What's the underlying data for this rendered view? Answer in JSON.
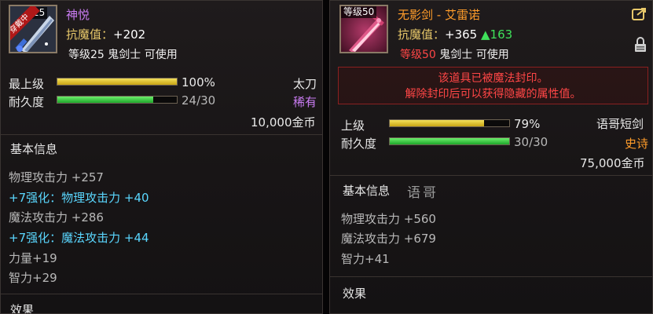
{
  "left": {
    "icon": {
      "level_tag": "25",
      "tag_label": "穿戴中",
      "tag_top": "等"
    },
    "name": "神悦",
    "magic_resist_label": "抗魔值：",
    "magic_resist_value": "+202",
    "requirement": "等级25 鬼剑士 可使用",
    "level_row": {
      "label": "最上级",
      "percent": "100%",
      "fill": 1.0,
      "type": "太刀"
    },
    "durability_row": {
      "label": "耐久度",
      "value": "24/30",
      "fill": 0.8,
      "grade": "稀有"
    },
    "price": "10,000金币",
    "section_basic": "基本信息",
    "stats": [
      {
        "text": "物理攻击力 +257",
        "style": "gray"
      },
      {
        "text": "+7强化：物理攻击力 +40",
        "style": "cyan"
      },
      {
        "text": "魔法攻击力 +286",
        "style": "gray"
      },
      {
        "text": "+7强化：魔法攻击力 +44",
        "style": "cyan"
      },
      {
        "text": "力量+19",
        "style": "gray"
      },
      {
        "text": "智力+29",
        "style": "gray"
      }
    ],
    "section_effect": "效果"
  },
  "right": {
    "icon": {
      "level_tag": "等级50"
    },
    "name": "无影剑 - 艾雷诺",
    "magic_resist_label": "抗魔值：",
    "magic_resist_value": "+365",
    "magic_resist_bonus": "▲163",
    "requirement_level": "等级50",
    "requirement_rest": " 鬼剑士 可使用",
    "seal_line1": "该道具已被魔法封印。",
    "seal_line2": "解除封印后可以获得隐藏的属性值。",
    "level_row": {
      "label": "上级",
      "percent": "79%",
      "fill": 0.79,
      "type": "语哥短剑"
    },
    "durability_row": {
      "label": "耐久度",
      "value": "30/30",
      "fill": 1.0,
      "grade": "史诗"
    },
    "price": "75,000金币",
    "section_basic": "基本信息",
    "watermark": "语哥",
    "stats": [
      {
        "text": "物理攻击力 +560"
      },
      {
        "text": "魔法攻击力 +679"
      },
      {
        "text": "智力+41"
      }
    ],
    "section_effect": "效果"
  },
  "colors": {
    "purple_name": "#c97cf2",
    "orange_name": "#ff9c2a",
    "gold_stat": "#e8c86a",
    "enhance_cyan": "#5ad7ff",
    "seal_red": "#ff4646",
    "bonus_green": "#3fe05a"
  },
  "icons": [
    "sword-icon",
    "dagger-icon",
    "share-icon",
    "lock-icon"
  ]
}
